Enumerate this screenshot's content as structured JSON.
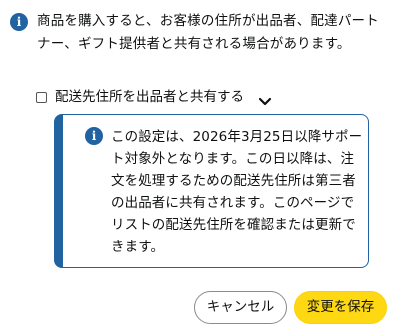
{
  "notice": {
    "text": "商品を購入すると、お客様の住所が出品者、配達パートナー、ギフト提供者と共有される場合があります。",
    "icon": "info-icon"
  },
  "option": {
    "label": "配送先住所を出品者と共有する",
    "checked": false,
    "chevron_icon": "chevron-down-icon"
  },
  "alert": {
    "text": "この設定は、2026年3月25日以降サポート対象外となります。この日以降は、注文を処理するための配送先住所は第三者の出品者に共有されます。このページでリストの配送先住所を確認または更新できます。",
    "icon": "info-icon",
    "accent": "#2162a1"
  },
  "buttons": {
    "cancel_label": "キャンセル",
    "save_label": "変更を保存",
    "save_color": "#ffd814"
  }
}
